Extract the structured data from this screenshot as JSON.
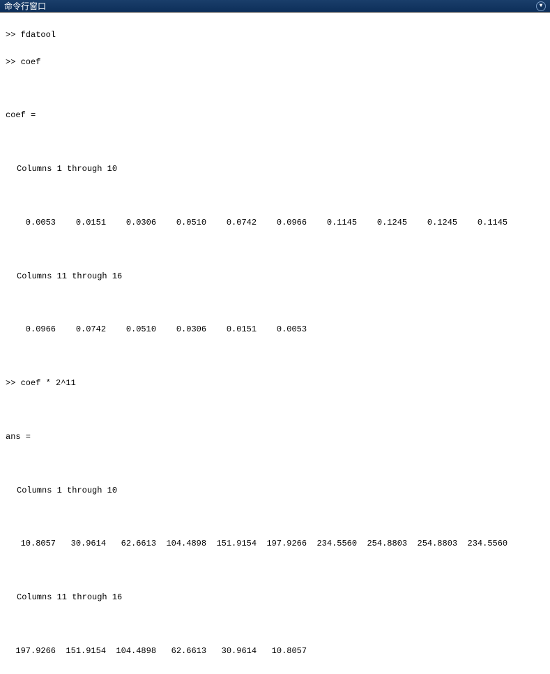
{
  "titlebar": {
    "title": "命令行窗口",
    "dropdown_icon": "▼"
  },
  "console": {
    "prompt1": ">> fdatool",
    "prompt2": ">> coef",
    "var1_header": "coef =",
    "cols1_header": "Columns 1 through 10",
    "cols1_values": "    0.0053    0.0151    0.0306    0.0510    0.0742    0.0966    0.1145    0.1245    0.1245    0.1145",
    "cols2_header": "Columns 11 through 16",
    "cols2_values": "    0.0966    0.0742    0.0510    0.0306    0.0151    0.0053",
    "prompt3": ">> coef * 2^11",
    "var2_header": "ans =",
    "cols3_header": "Columns 1 through 10",
    "cols3_values": "   10.8057   30.9614   62.6613  104.4898  151.9154  197.9266  234.5560  254.8803  254.8803  234.5560",
    "cols4_header": "Columns 11 through 16",
    "cols4_values": "  197.9266  151.9154  104.4898   62.6613   30.9614   10.8057"
  }
}
